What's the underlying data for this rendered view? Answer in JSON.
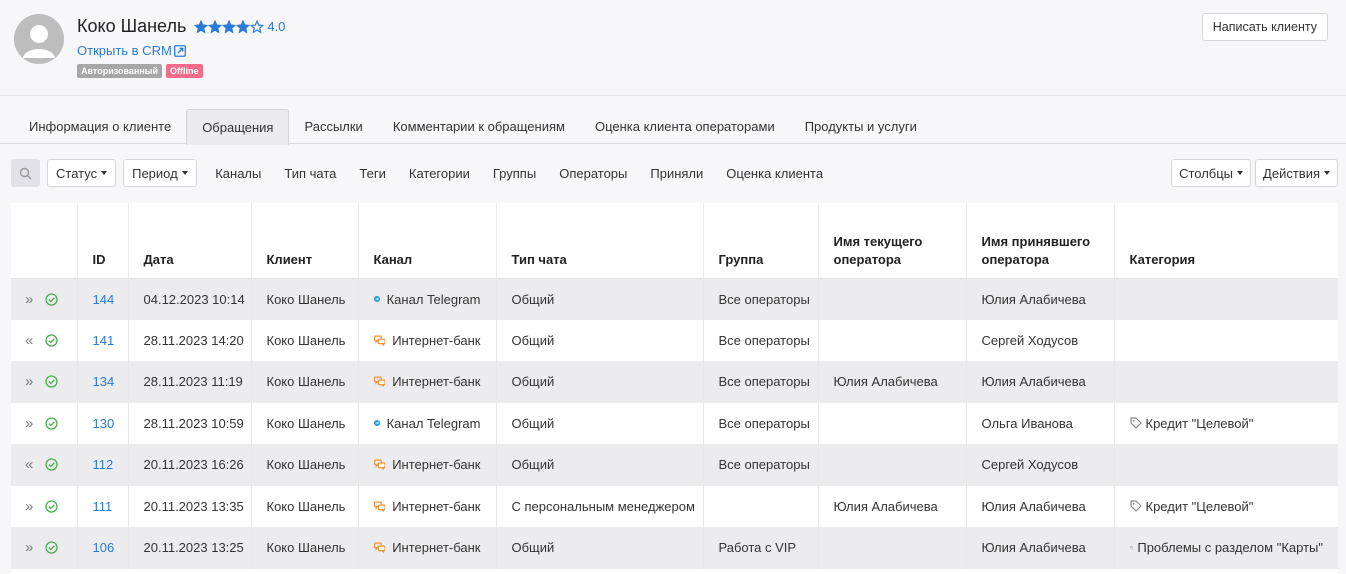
{
  "header": {
    "client_name": "Коко Шанель",
    "rating_value": "4.0",
    "rating": 4,
    "rating_max": 5,
    "crm_link": "Открыть в CRM",
    "badge_auth": "Авторизованный",
    "badge_offline": "Offline",
    "write_button": "Написать клиенту"
  },
  "tabs": [
    {
      "label": "Информация о клиенте"
    },
    {
      "label": "Обращения",
      "active": true
    },
    {
      "label": "Рассылки"
    },
    {
      "label": "Комментарии к обращениям"
    },
    {
      "label": "Оценка клиента операторами"
    },
    {
      "label": "Продукты и услуги"
    }
  ],
  "filters": {
    "status": "Статус",
    "period": "Период",
    "links": [
      "Каналы",
      "Тип чата",
      "Теги",
      "Категории",
      "Группы",
      "Операторы",
      "Приняли",
      "Оценка клиента"
    ],
    "columns": "Столбцы",
    "actions": "Действия"
  },
  "table": {
    "columns": [
      "",
      "ID",
      "Дата",
      "Клиент",
      "Канал",
      "Тип чата",
      "Группа",
      "Имя текущего оператора",
      "Имя принявшего оператора",
      "Категория"
    ],
    "rows": [
      {
        "expand": "»",
        "id": "144",
        "date": "04.12.2023 10:14",
        "client": "Коко Шанель",
        "channel": "Канал Telegram",
        "channel_icon": "telegram-icon",
        "chat_type": "Общий",
        "group": "Все операторы",
        "current_op": "",
        "accepted_op": "Юлия Алабичева",
        "category": ""
      },
      {
        "expand": "«",
        "id": "141",
        "date": "28.11.2023 14:20",
        "client": "Коко Шанель",
        "channel": "Интернет-банк",
        "channel_icon": "chat-bubbles-icon",
        "chat_type": "Общий",
        "group": "Все операторы",
        "current_op": "",
        "accepted_op": "Сергей Ходусов",
        "category": ""
      },
      {
        "expand": "»",
        "id": "134",
        "date": "28.11.2023 11:19",
        "client": "Коко Шанель",
        "channel": "Интернет-банк",
        "channel_icon": "chat-bubbles-icon",
        "chat_type": "Общий",
        "group": "Все операторы",
        "current_op": "Юлия Алабичева",
        "accepted_op": "Юлия Алабичева",
        "category": ""
      },
      {
        "expand": "»",
        "id": "130",
        "date": "28.11.2023 10:59",
        "client": "Коко Шанель",
        "channel": "Канал Telegram",
        "channel_icon": "telegram-icon",
        "chat_type": "Общий",
        "group": "Все операторы",
        "current_op": "",
        "accepted_op": "Ольга Иванова",
        "category": "Кредит \"Целевой\""
      },
      {
        "expand": "«",
        "id": "112",
        "date": "20.11.2023 16:26",
        "client": "Коко Шанель",
        "channel": "Интернет-банк",
        "channel_icon": "chat-bubbles-icon",
        "chat_type": "Общий",
        "group": "Все операторы",
        "current_op": "",
        "accepted_op": "Сергей Ходусов",
        "category": ""
      },
      {
        "expand": "»",
        "id": "111",
        "date": "20.11.2023 13:35",
        "client": "Коко Шанель",
        "channel": "Интернет-банк",
        "channel_icon": "chat-bubbles-icon",
        "chat_type": "С персональным менеджером",
        "group": "",
        "current_op": "Юлия Алабичева",
        "accepted_op": "Юлия Алабичева",
        "category": "Кредит \"Целевой\""
      },
      {
        "expand": "»",
        "id": "106",
        "date": "20.11.2023 13:25",
        "client": "Коко Шанель",
        "channel": "Интернет-банк",
        "channel_icon": "chat-bubbles-icon",
        "chat_type": "Общий",
        "group": "Работа с VIP",
        "current_op": "",
        "accepted_op": "Юлия Алабичева",
        "category": "Проблемы с разделом \"Карты\""
      }
    ]
  },
  "colors": {
    "accent": "#2a7ad8",
    "star": "#2a7ad8",
    "badge_auth": "#a7a7a7",
    "badge_offline": "#f36d8a",
    "status_ok": "#4caf50",
    "channel_bank": "#f08a24",
    "channel_telegram": "#2a9fd8"
  }
}
